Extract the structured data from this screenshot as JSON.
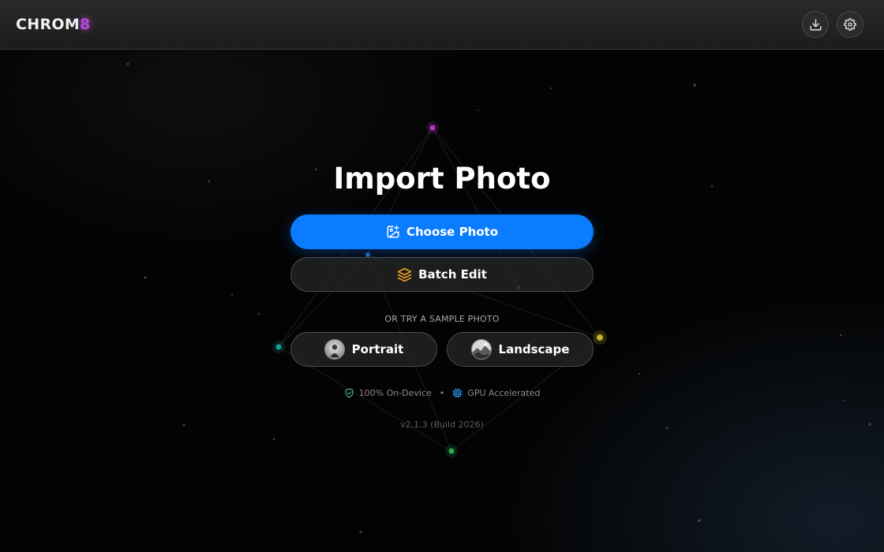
{
  "header": {
    "logo_text": "CHROM",
    "logo_accent": "8",
    "download_icon": "download-icon",
    "settings_icon": "gear-icon"
  },
  "main": {
    "title": "Import Photo",
    "choose_label": "Choose Photo",
    "choose_icon": "image-add-icon",
    "batch_label": "Batch Edit",
    "batch_icon": "layers-icon",
    "or_label": "OR TRY A SAMPLE PHOTO",
    "samples": [
      {
        "label": "Portrait",
        "icon": "portrait-thumbnail"
      },
      {
        "label": "Landscape",
        "icon": "landscape-thumbnail"
      }
    ],
    "features": [
      {
        "label": "100% On-Device",
        "icon": "shield-check-icon",
        "color": "#3fbf7f"
      },
      {
        "label": "GPU Accelerated",
        "icon": "chip-icon",
        "color": "#2a9df4"
      }
    ],
    "separator": "•",
    "version": "v2.1.3 (Build 2026)"
  },
  "colors": {
    "primary": "#0a7cff",
    "logo_accent": "#b44bd8",
    "batch_icon": "#f5a623",
    "background": "#030303"
  }
}
